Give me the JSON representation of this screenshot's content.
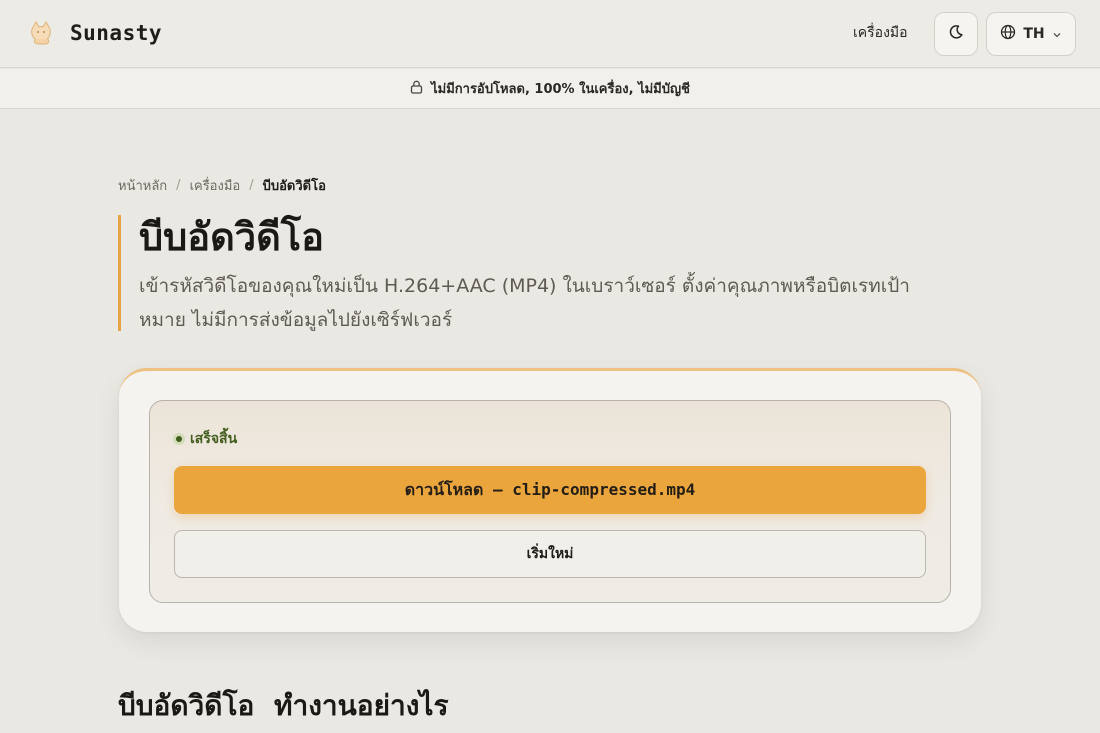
{
  "header": {
    "brand_name": "Sunasty",
    "logo_icon": "cat-logo-icon",
    "nav_tools": "เครื่องมือ",
    "theme_icon": "moon-icon",
    "lang_icon": "globe-icon",
    "lang_label": "TH",
    "lang_caret_icon": "chevron-down-icon"
  },
  "banner": {
    "icon": "lock-icon",
    "text": "ไม่มีการอัปโหลด, 100% ในเครื่อง, ไม่มีบัญชี"
  },
  "breadcrumb": {
    "home": "หน้าหลัก",
    "tools": "เครื่องมือ",
    "current": "บีบอัดวิดีโอ",
    "separator": "/"
  },
  "page": {
    "title": "บีบอัดวิดีโอ",
    "subtitle": "เข้ารหัสวิดีโอของคุณใหม่เป็น H.264+AAC (MP4) ในเบราว์เซอร์ ตั้งค่าคุณภาพหรือบิตเรทเป้าหมาย ไม่มีการส่งข้อมูลไปยังเซิร์ฟเวอร์"
  },
  "result": {
    "status": "เสร็จสิ้น",
    "download_label": "ดาวน์โหลด — clip-compressed.mp4",
    "restart_label": "เริ่มใหม่"
  },
  "section": {
    "title": "บีบอัดวิดีโอ ทำงานอย่างไร"
  },
  "colors": {
    "accent": "#eba53d",
    "status_green": "#435e1f",
    "background": "#eae8e3"
  }
}
